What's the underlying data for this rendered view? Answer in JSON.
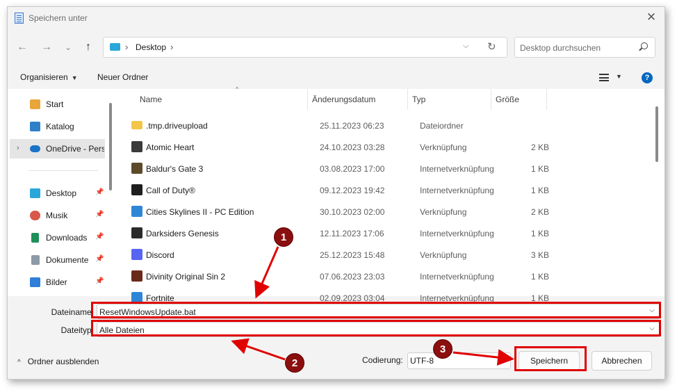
{
  "window": {
    "title": "Speichern unter",
    "close_glyph": "✕"
  },
  "nav": {
    "back": "←",
    "forward": "→",
    "recent": "⌄",
    "up": "↑"
  },
  "address": {
    "sep": "›",
    "crumb": "Desktop",
    "chevron": "⌵",
    "refresh": "↻"
  },
  "search": {
    "placeholder": "Desktop durchsuchen"
  },
  "commands": {
    "organize": "Organisieren",
    "new_folder": "Neuer Ordner",
    "caret": "▼",
    "help": "?"
  },
  "sidebar": {
    "items": [
      {
        "label": "Start",
        "icon": "home-icon",
        "color": "#e8a53a"
      },
      {
        "label": "Katalog",
        "icon": "gallery-icon",
        "color": "#2f80c8"
      },
      {
        "label": "OneDrive - Persönlich",
        "icon": "cloud-icon",
        "color": "#1a73c8",
        "selected": true
      },
      {
        "label": "Desktop",
        "icon": "desktop-icon",
        "color": "#2aa7d9"
      },
      {
        "label": "Musik",
        "icon": "music-icon",
        "color": "#d9584a"
      },
      {
        "label": "Downloads",
        "icon": "download-icon",
        "color": "#1f8f5a"
      },
      {
        "label": "Dokumente",
        "icon": "documents-icon",
        "color": "#8d9aa8"
      },
      {
        "label": "Bilder",
        "icon": "pictures-icon",
        "color": "#2f7ed8"
      }
    ],
    "pin_glyph": "📌",
    "expand_glyph": "›"
  },
  "columns": {
    "name": "Name",
    "date": "Änderungsdatum",
    "type": "Typ",
    "size": "Größe",
    "sort_glyph": "^"
  },
  "files": [
    {
      "name": ".tmp.driveupload",
      "date": "25.11.2023 06:23",
      "type": "Dateiordner",
      "size": "",
      "icon": "folder-icon",
      "color": "#f3c64b"
    },
    {
      "name": "Atomic Heart",
      "date": "24.10.2023 03:28",
      "type": "Verknüpfung",
      "size": "2 KB",
      "icon": "game-shortcut-icon",
      "color": "#3a3a3a"
    },
    {
      "name": "Baldur's Gate 3",
      "date": "03.08.2023 17:00",
      "type": "Internetverknüpfung",
      "size": "1 KB",
      "icon": "game-shortcut-icon",
      "color": "#5c4a2a"
    },
    {
      "name": "Call of Duty®",
      "date": "09.12.2023 19:42",
      "type": "Internetverknüpfung",
      "size": "1 KB",
      "icon": "game-shortcut-icon",
      "color": "#1e1e1e"
    },
    {
      "name": "Cities Skylines II - PC Edition",
      "date": "30.10.2023 02:00",
      "type": "Verknüpfung",
      "size": "2 KB",
      "icon": "game-shortcut-icon",
      "color": "#2f86d6"
    },
    {
      "name": "Darksiders Genesis",
      "date": "12.11.2023 17:06",
      "type": "Internetverknüpfung",
      "size": "1 KB",
      "icon": "game-shortcut-icon",
      "color": "#2b2b2b"
    },
    {
      "name": "Discord",
      "date": "25.12.2023 15:48",
      "type": "Verknüpfung",
      "size": "3 KB",
      "icon": "discord-icon",
      "color": "#5865f2"
    },
    {
      "name": "Divinity Original Sin 2",
      "date": "07.06.2023 23:03",
      "type": "Internetverknüpfung",
      "size": "1 KB",
      "icon": "game-shortcut-icon",
      "color": "#6a2a1a"
    },
    {
      "name": "Fortnite",
      "date": "02.09.2023 03:04",
      "type": "Internetverknüpfung",
      "size": "1 KB",
      "icon": "game-shortcut-icon",
      "color": "#2f86d6"
    }
  ],
  "fields": {
    "filename_label": "Dateiname:",
    "filename_value": "ResetWindowsUpdate.bat",
    "filetype_label": "Dateityp:",
    "filetype_value": "Alle Dateien",
    "chevron": "⌵"
  },
  "footer": {
    "hide_folders": "Ordner ausblenden",
    "hide_glyph": "^",
    "encoding_label": "Codierung:",
    "encoding_value": "UTF-8",
    "save": "Speichern",
    "cancel": "Abbrechen"
  },
  "annotations": {
    "markers": [
      "1",
      "2",
      "3"
    ],
    "color": "#e00000"
  }
}
